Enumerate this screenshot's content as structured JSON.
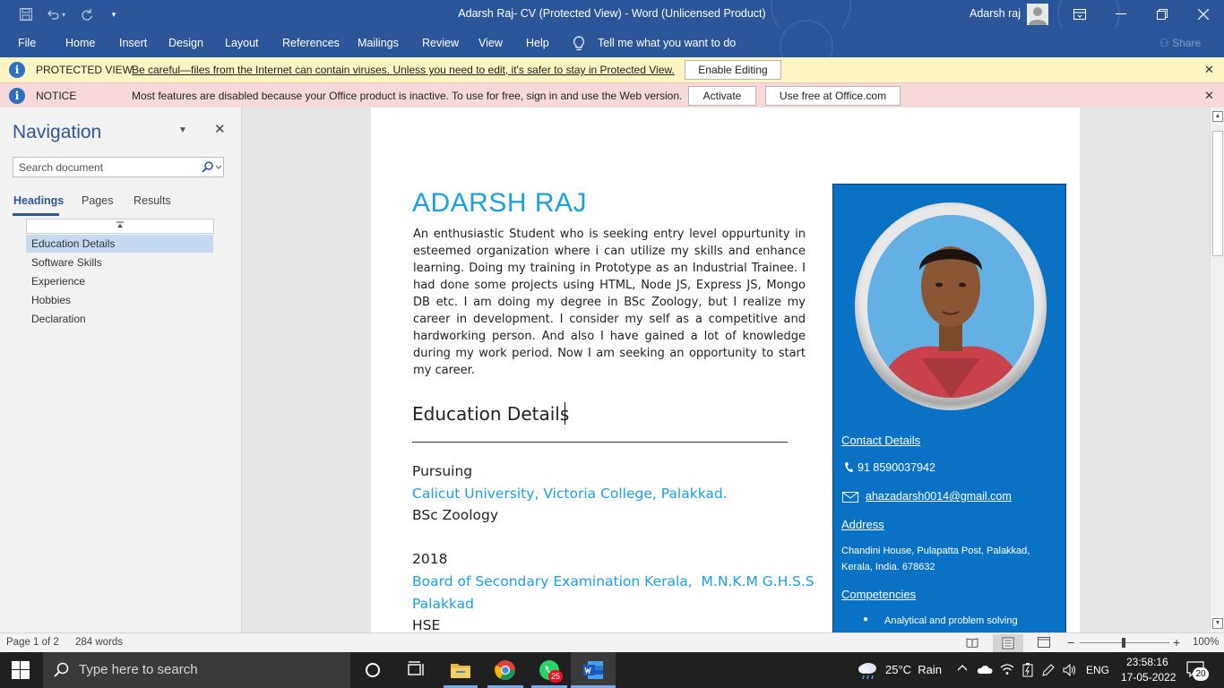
{
  "window": {
    "title": "Adarsh Raj- CV (Protected View)  -  Word (Unlicensed Product)",
    "user_name": "Adarsh raj"
  },
  "ribbon": {
    "tabs": [
      "File",
      "Home",
      "Insert",
      "Design",
      "Layout",
      "References",
      "Mailings",
      "Review",
      "View",
      "Help"
    ],
    "tell_me": "Tell me what you want to do",
    "share": "Share"
  },
  "protected_bar": {
    "label": "PROTECTED VIEW",
    "message": "Be careful—files from the Internet can contain viruses. Unless you need to edit, it's safer to stay in Protected View.",
    "button": "Enable Editing"
  },
  "notice_bar": {
    "label": "NOTICE",
    "message": "Most features are disabled because your Office product is inactive. To use for free, sign in and use the Web version.",
    "activate": "Activate",
    "use_free": "Use free at Office.com"
  },
  "navigation": {
    "title": "Navigation",
    "search_placeholder": "Search document",
    "tabs": [
      "Headings",
      "Pages",
      "Results"
    ],
    "headings": [
      "Education Details",
      "Software Skills",
      "Experience",
      "Hobbies",
      "Declaration"
    ]
  },
  "document": {
    "name": "ADARSH RAJ",
    "summary": " An enthusiastic Student who is seeking entry level oppurtunity in esteemed organization where i can utilize my skills and enhance learning. Doing my training in Prototype as an Industrial Trainee. I had done some projects using HTML, Node JS, Express JS, Mongo DB etc. I am doing my degree in BSc Zoology, but I realize my  career in development. I consider my self as a competitive and hardworking person. And also I have gained a lot of knowledge during my work period. Now I am seeking an opportunity to start my career.",
    "education_heading": "Education Details",
    "edu1_year": "Pursuing",
    "edu1_institution": "Calicut University, Victoria College, Palakkad.",
    "edu1_course": "BSc Zoology",
    "edu2_year": "2018",
    "edu2_institution_line1": "Board of Secondary Examination Kerala,  M.N.K.M G.H.S.S",
    "edu2_institution_line2": "Palakkad",
    "edu2_course": "HSE",
    "sidebar": {
      "contact_heading": "Contact Details",
      "phone": "91 8590037942",
      "email": "ahazadarsh0014@gmail.com",
      "address_heading": "Address",
      "address_line1": "Chandini House, Pulapatta Post, Palakkad,",
      "address_line2": "Kerala, India. 678632",
      "competencies_heading": "Competencies",
      "competency1": "Analytical and problem solving"
    }
  },
  "status_bar": {
    "page": "Page 1 of 2",
    "words": "284 words",
    "zoom": "100%"
  },
  "taskbar": {
    "search_placeholder": "Type here to search",
    "whatsapp_badge": "25",
    "weather": "25°C  Rain",
    "language": "ENG",
    "time": "23:58:16",
    "date": "17-05-2022",
    "notifications": "20"
  },
  "colors": {
    "word_blue": "#2b579a",
    "accent_cyan": "#1ba1e2",
    "sidebar_blue": "#0a72c5",
    "protected_bg": "#fdf6c3",
    "notice_bg": "#f7d9da"
  }
}
